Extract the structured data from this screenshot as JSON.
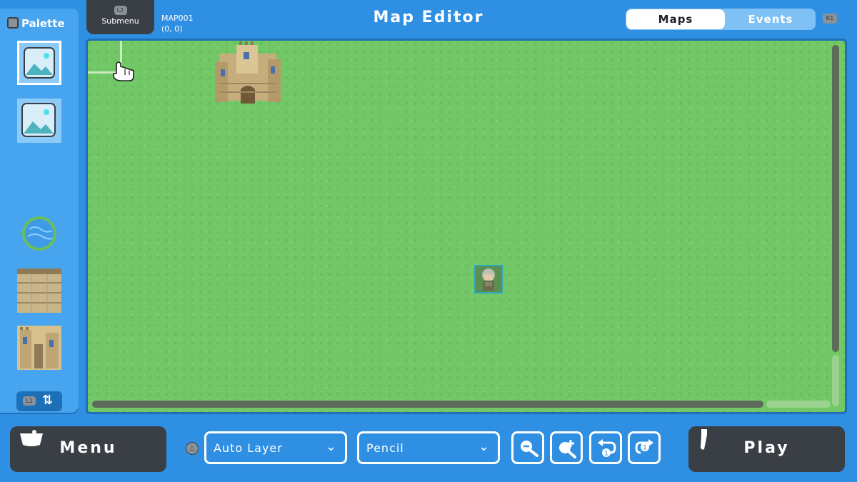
{
  "header": {
    "submenu_badge": "L2",
    "submenu_label": "Submenu",
    "map_id": "MAP001",
    "coords": "(0, 0)",
    "title": "Map Editor",
    "tabs": [
      {
        "label": "Maps",
        "active": true
      },
      {
        "label": "Events",
        "active": false
      }
    ],
    "r1_badge": "R1"
  },
  "palette": {
    "title": "Palette",
    "tiles": [
      "image-placeholder",
      "image-placeholder",
      "water-tile",
      "stone-wall-tile",
      "castle-tile"
    ],
    "swap_badge": "L1",
    "swap_icon": "⇅"
  },
  "canvas": {
    "objects": [
      "castle",
      "character-sprite"
    ]
  },
  "bottom": {
    "menu_label": "Menu",
    "triangle_badge": "△",
    "layer_select": "Auto Layer",
    "tool_select": "Pencil",
    "tools": [
      "zoom-out",
      "zoom-in",
      "undo",
      "redo"
    ],
    "play_label": "Play"
  },
  "colors": {
    "background": "#2f8fe3",
    "panel": "#3a3f46",
    "grass": "#72c766"
  }
}
